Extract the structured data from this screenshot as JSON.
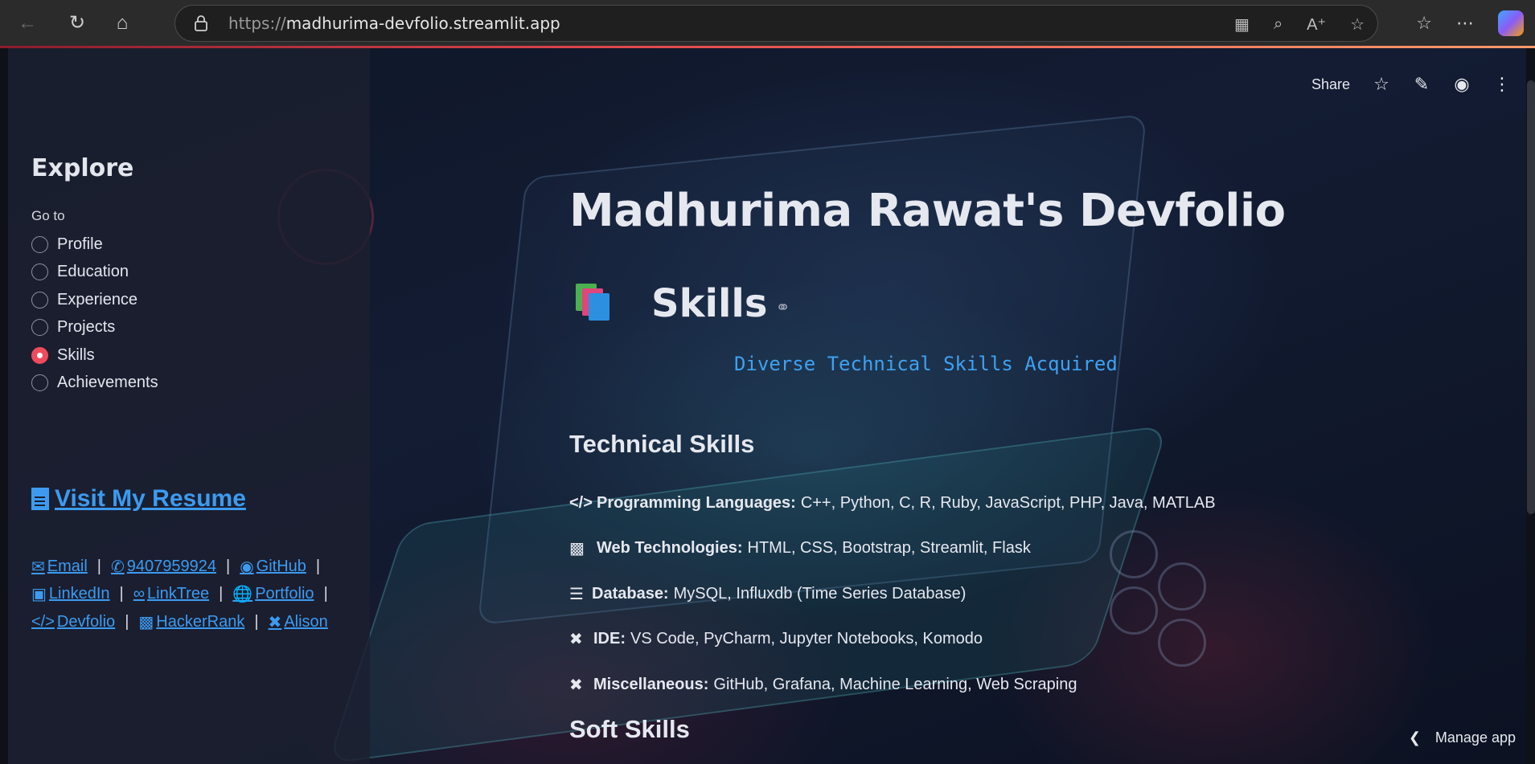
{
  "browser": {
    "url_scheme": "https://",
    "url_host": "madhurima-devfolio.streamlit.app"
  },
  "toolbar": {
    "share_label": "Share"
  },
  "sidebar": {
    "heading": "Explore",
    "radio_label": "Go to",
    "items": [
      {
        "label": "Profile",
        "checked": false
      },
      {
        "label": "Education",
        "checked": false
      },
      {
        "label": "Experience",
        "checked": false
      },
      {
        "label": "Projects",
        "checked": false
      },
      {
        "label": "Skills",
        "checked": true
      },
      {
        "label": "Achievements",
        "checked": false
      }
    ],
    "resume_link": "Visit My Resume",
    "links": {
      "email": "Email",
      "phone": "9407959924",
      "github": "GitHub",
      "linkedin": "LinkedIn",
      "linktree": "LinkTree",
      "portfolio": "Portfolio",
      "devfolio": "Devfolio",
      "hackerrank": "HackerRank",
      "alison": "Alison"
    },
    "separator": "|"
  },
  "main": {
    "title": "Madhurima Rawat's Devfolio",
    "section_title": "Skills",
    "subtitle": "Diverse Technical Skills Acquired",
    "technical_heading": "Technical Skills",
    "skills": [
      {
        "icon": "code-icon",
        "label": "Programming Languages:",
        "value": "C++, Python, C, R, Ruby, JavaScript, PHP, Java, MATLAB"
      },
      {
        "icon": "laptop-code-icon",
        "label": "Web Technologies:",
        "value": "HTML, CSS, Bootstrap, Streamlit, Flask"
      },
      {
        "icon": "database-icon",
        "label": "Database:",
        "value": "MySQL, Influxdb (Time Series Database)"
      },
      {
        "icon": "tools-icon",
        "label": "IDE:",
        "value": "VS Code, PyCharm, Jupyter Notebooks, Komodo"
      },
      {
        "icon": "screwdriver-wrench-icon",
        "label": "Miscellaneous:",
        "value": "GitHub, Grafana, Machine Learning, Web Scraping"
      }
    ],
    "soft_heading": "Soft Skills"
  },
  "footer": {
    "manage_app": "Manage app"
  },
  "colors": {
    "accent": "#ef4b5c",
    "link": "#3c9bf0",
    "subtitle": "#3fa1f0"
  }
}
